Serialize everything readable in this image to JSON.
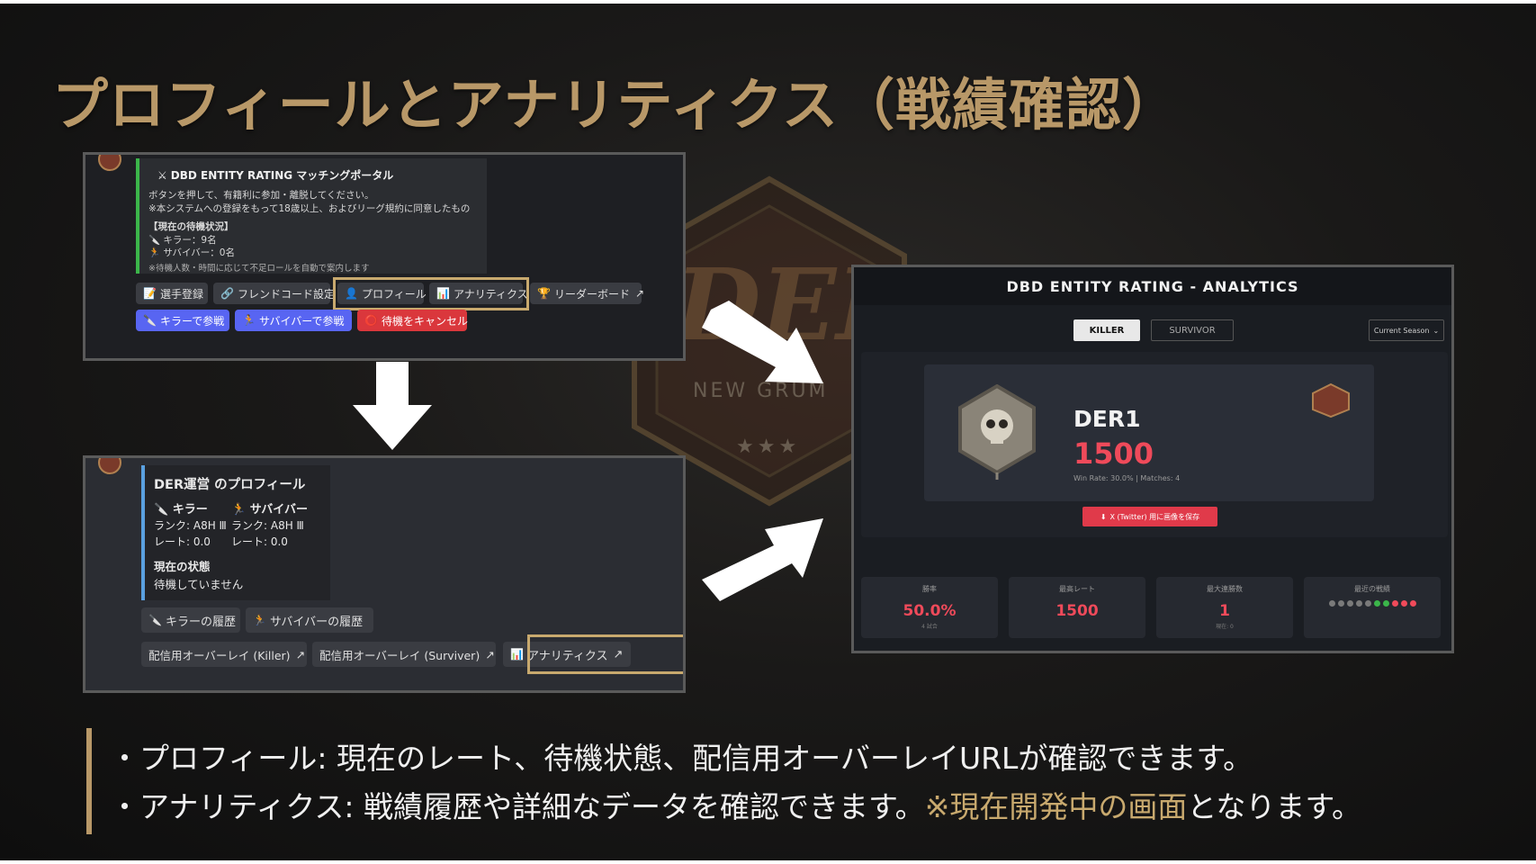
{
  "title": "プロフィールとアナリティクス（戦績確認）",
  "background_emblem": {
    "text": "DER",
    "subtitle": "NEW GRUM",
    "stars": "★★★"
  },
  "portal_panel": {
    "header": "DBD ENTITY RATING マッチングポータル",
    "line1": "ボタンを押して、有籍利に参加・離脱してください。",
    "line2": "※本システムへの登録をもって18歳以上、およびリーグ規約に同意したもの",
    "status_heading": "【現在の待機状況】",
    "killer_count": "キラー：9名",
    "survivor_count": "サバイバー：0名",
    "note": "※待機人数・時間に応じて不足ロールを自動で案内します",
    "buttons_row1": [
      "選手登録",
      "フレンドコード設定",
      "プロフィール",
      "アナリティクス",
      "リーダーボード"
    ],
    "buttons_row2": [
      "キラーで参戦",
      "サバイバーで参戦",
      "待機をキャンセル"
    ]
  },
  "profile_panel": {
    "title": "DER運営 のプロフィール",
    "killer_label": "キラー",
    "survivor_label": "サバイバー",
    "killer_rank": "ランク: A8H Ⅲ",
    "survivor_rank": "ランク: A8H Ⅲ",
    "killer_rate": "レート: 0.0",
    "survivor_rate": "レート: 0.0",
    "status_heading": "現在の状態",
    "status_value": "待機していません",
    "buttons_row1": [
      "キラーの履歴",
      "サバイバーの履歴"
    ],
    "buttons_row2": [
      "配信用オーバーレイ (Killer)",
      "配信用オーバーレイ (Surviver)",
      "アナリティクス"
    ]
  },
  "analytics_panel": {
    "header": "DBD ENTITY RATING - ANALYTICS",
    "tabs": [
      "KILLER",
      "SURVIVOR"
    ],
    "active_tab": "KILLER",
    "season_select": "Current Season",
    "player_name": "DER1",
    "rating": "1500",
    "summary": "Win Rate: 30.0% | Matches: 4",
    "share_button": "X (Twitter) 用に画像を保存",
    "stats": [
      {
        "label": "勝率",
        "value": "50.0%",
        "sub": "4 試合"
      },
      {
        "label": "最高レート",
        "value": "1500",
        "sub": ""
      },
      {
        "label": "最大連勝数",
        "value": "1",
        "sub": "現在: 0"
      },
      {
        "label": "最近の戦績",
        "value": "",
        "sub": ""
      }
    ],
    "recent_results": [
      "loss",
      "loss",
      "loss",
      "loss",
      "loss",
      "win",
      "win",
      "loss",
      "loss",
      "loss"
    ],
    "colors": {
      "accent": "#ef4a5a",
      "win": "#3bb54a",
      "loss": "#ef4a5a",
      "neutral": "#7a7a7a"
    }
  },
  "bullets": {
    "b1": "・プロフィール: 現在のレート、待機状態、配信用オーバーレイURLが確認できます。",
    "b2_prefix": "・アナリティクス: 戦績履歴や詳細なデータを確認できます。",
    "b2_highlight": "※現在開発中の画面",
    "b2_suffix": "となります。"
  },
  "colors": {
    "gold": "#c8a96e",
    "title": "#b89868"
  }
}
